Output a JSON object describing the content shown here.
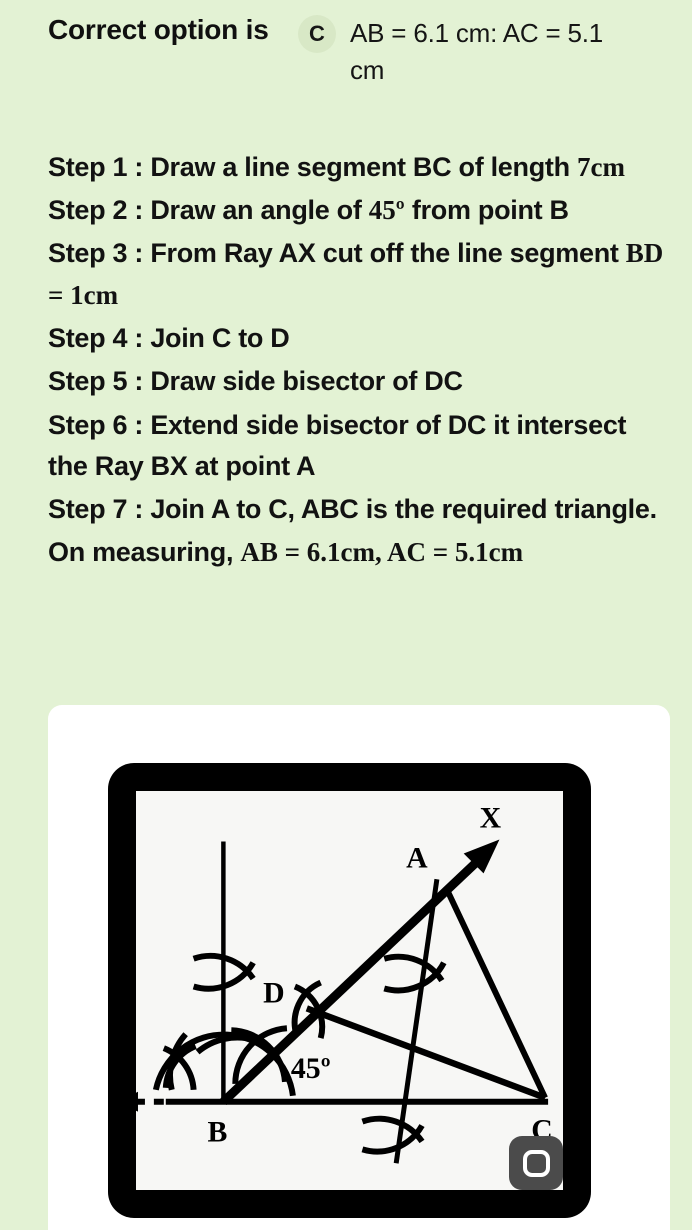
{
  "header": {
    "correct_label": "Correct option is",
    "option_letter": "C",
    "option_text": "AB = 6.1 cm: AC = 5.1 cm",
    "badge_color": "#d8e8c6"
  },
  "page": {
    "background_color": "#e3f2d4",
    "text_color": "#121212"
  },
  "solution": {
    "steps": [
      {
        "label": "Step 1 : Draw a line segment BC of length ",
        "math": "7cm"
      },
      {
        "label": "Step 2 : Draw an angle of ",
        "math": "45º",
        "tail": " from point B"
      },
      {
        "label": "Step 3 : From Ray AX cut off the line segment ",
        "math": "BD = 1cm"
      },
      {
        "label": "Step 4 : Join C to D",
        "math": ""
      },
      {
        "label": "Step 5 : Draw side bisector of DC",
        "math": ""
      },
      {
        "label": "Step 6 : Extend side bisector of DC it intersect the Ray BX at point A",
        "math": ""
      },
      {
        "label": "Step 7 : Join A to C, ABC is the required triangle.",
        "math": ""
      },
      {
        "label": "On measuring, ",
        "math": "AB = 6.1cm, AC = 5.1cm"
      }
    ]
  },
  "figure": {
    "caption_badge": "reload-icon",
    "frame_color": "#000000",
    "canvas_color": "#f7f7f5",
    "labels": {
      "x": "X",
      "a": "A",
      "d": "D",
      "b": "B",
      "c": "C",
      "angle": "45º"
    }
  }
}
